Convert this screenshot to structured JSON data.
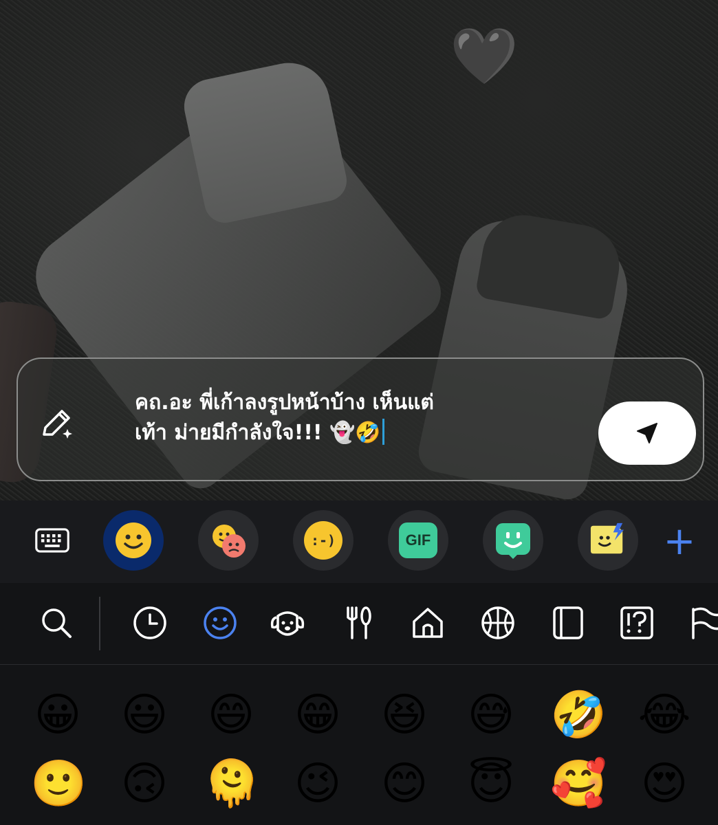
{
  "message": {
    "line1": "คถ.อะ พี่เก้าลงรูปหน้าบ้าง เห็นแต่",
    "line2": "เท้า ม่ายมีกำลังใจ!!! 👻🤣"
  },
  "photo": {
    "heart": "🖤"
  },
  "keyboard_tabs": [
    {
      "name": "keyboard-icon"
    },
    {
      "name": "emoji-tab",
      "active": true
    },
    {
      "name": "sticker-tab"
    },
    {
      "name": "emoticon-tab",
      "label": ":-)"
    },
    {
      "name": "gif-tab",
      "label": "GIF"
    },
    {
      "name": "bitmoji-tab"
    },
    {
      "name": "mojitok-tab"
    }
  ],
  "accent_color": "#4b82f0",
  "categories": [
    "search-icon",
    "recent-icon",
    "smileys-icon",
    "animals-icon",
    "food-icon",
    "travel-icon",
    "activity-icon",
    "objects-icon",
    "symbols-icon",
    "flags-icon"
  ],
  "emoji_rows": [
    [
      "😀",
      "😃",
      "😄",
      "😁",
      "😆",
      "😅",
      "🤣",
      "😂"
    ],
    [
      "🙂",
      "🙃",
      "🫠",
      "😉",
      "😊",
      "😇",
      "🥰",
      "😍"
    ]
  ]
}
